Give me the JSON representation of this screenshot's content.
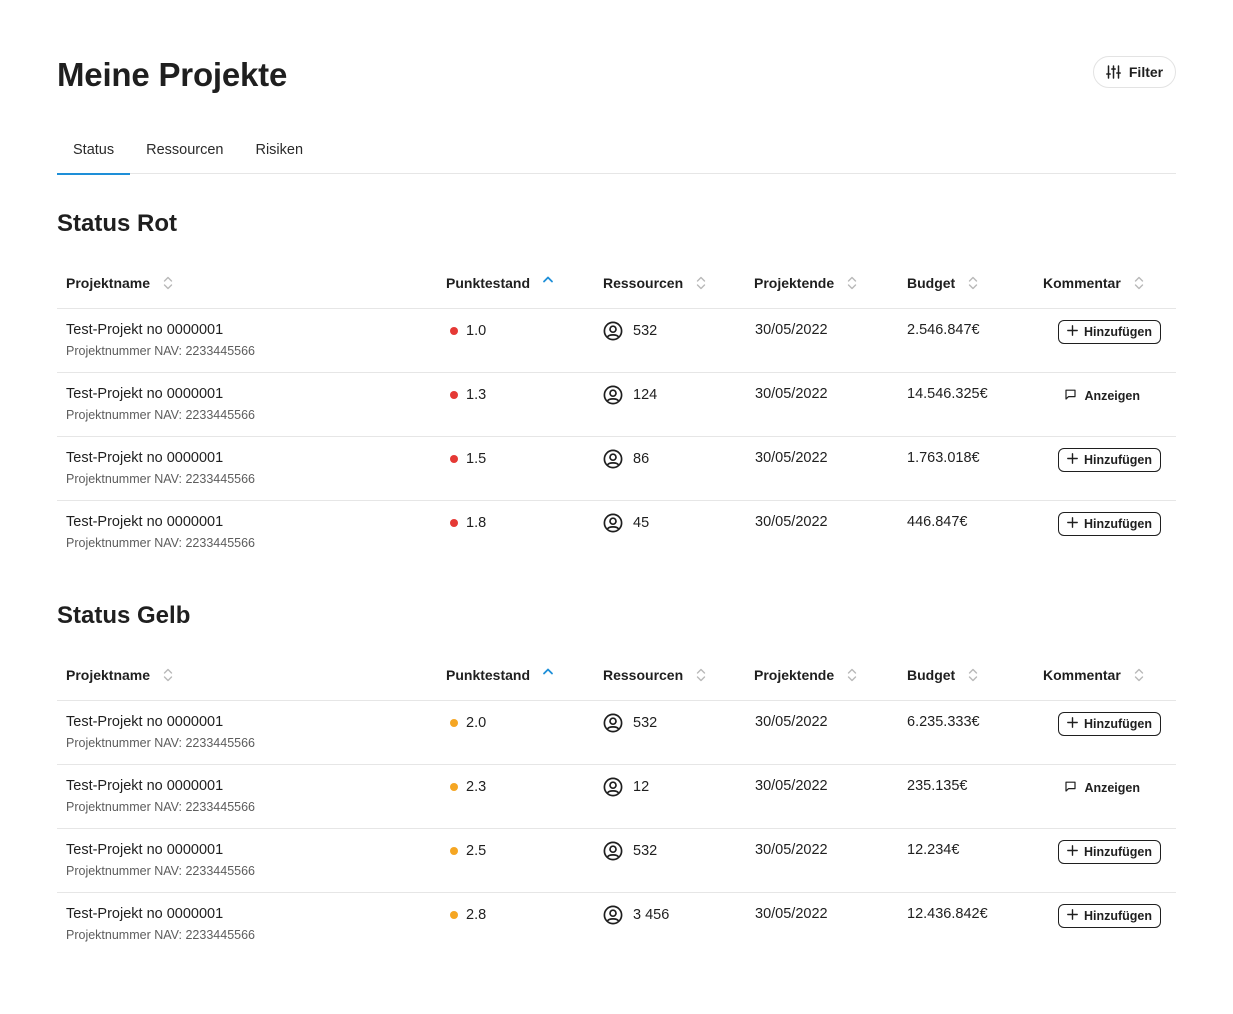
{
  "header": {
    "title": "Meine Projekte",
    "filter_label": "Filter"
  },
  "tabs": [
    {
      "label": "Status",
      "active": true
    },
    {
      "label": "Ressourcen",
      "active": false
    },
    {
      "label": "Risiken",
      "active": false
    }
  ],
  "columns": {
    "name": "Projektname",
    "score": "Punktestand",
    "resources": "Ressourcen",
    "end": "Projektende",
    "budget": "Budget",
    "comment": "Kommentar"
  },
  "colors": {
    "accent": "#1e8fd8",
    "red": "#e53935",
    "yellow": "#f5a623",
    "border": "#e6e6e6"
  },
  "sections": [
    {
      "title": "Status Rot",
      "status_color": "#e53935",
      "rows": [
        {
          "name": "Test-Projekt no 0000001",
          "number": "Projektnummer NAV: 2233445566",
          "score": "1.0",
          "resources": "532",
          "end": "30/05/2022",
          "budget": "2.546.847€",
          "comment": "Hinzufügen",
          "comment_type": "add"
        },
        {
          "name": "Test-Projekt no 0000001",
          "number": "Projektnummer NAV: 2233445566",
          "score": "1.3",
          "resources": "124",
          "end": "30/05/2022",
          "budget": "14.546.325€",
          "comment": "Anzeigen",
          "comment_type": "show"
        },
        {
          "name": "Test-Projekt no 0000001",
          "number": "Projektnummer NAV: 2233445566",
          "score": "1.5",
          "resources": "86",
          "end": "30/05/2022",
          "budget": "1.763.018€",
          "comment": "Hinzufügen",
          "comment_type": "add"
        },
        {
          "name": "Test-Projekt no 0000001",
          "number": "Projektnummer NAV: 2233445566",
          "score": "1.8",
          "resources": "45",
          "end": "30/05/2022",
          "budget": "446.847€",
          "comment": "Hinzufügen",
          "comment_type": "add"
        }
      ]
    },
    {
      "title": "Status Gelb",
      "status_color": "#f5a623",
      "rows": [
        {
          "name": "Test-Projekt no 0000001",
          "number": "Projektnummer NAV: 2233445566",
          "score": "2.0",
          "resources": "532",
          "end": "30/05/2022",
          "budget": "6.235.333€",
          "comment": "Hinzufügen",
          "comment_type": "add"
        },
        {
          "name": "Test-Projekt no 0000001",
          "number": "Projektnummer NAV: 2233445566",
          "score": "2.3",
          "resources": "12",
          "end": "30/05/2022",
          "budget": "235.135€",
          "comment": "Anzeigen",
          "comment_type": "show"
        },
        {
          "name": "Test-Projekt no 0000001",
          "number": "Projektnummer NAV: 2233445566",
          "score": "2.5",
          "resources": "532",
          "end": "30/05/2022",
          "budget": "12.234€",
          "comment": "Hinzufügen",
          "comment_type": "add"
        },
        {
          "name": "Test-Projekt no 0000001",
          "number": "Projektnummer NAV: 2233445566",
          "score": "2.8",
          "resources": "3 456",
          "end": "30/05/2022",
          "budget": "12.436.842€",
          "comment": "Hinzufügen",
          "comment_type": "add"
        }
      ]
    }
  ]
}
